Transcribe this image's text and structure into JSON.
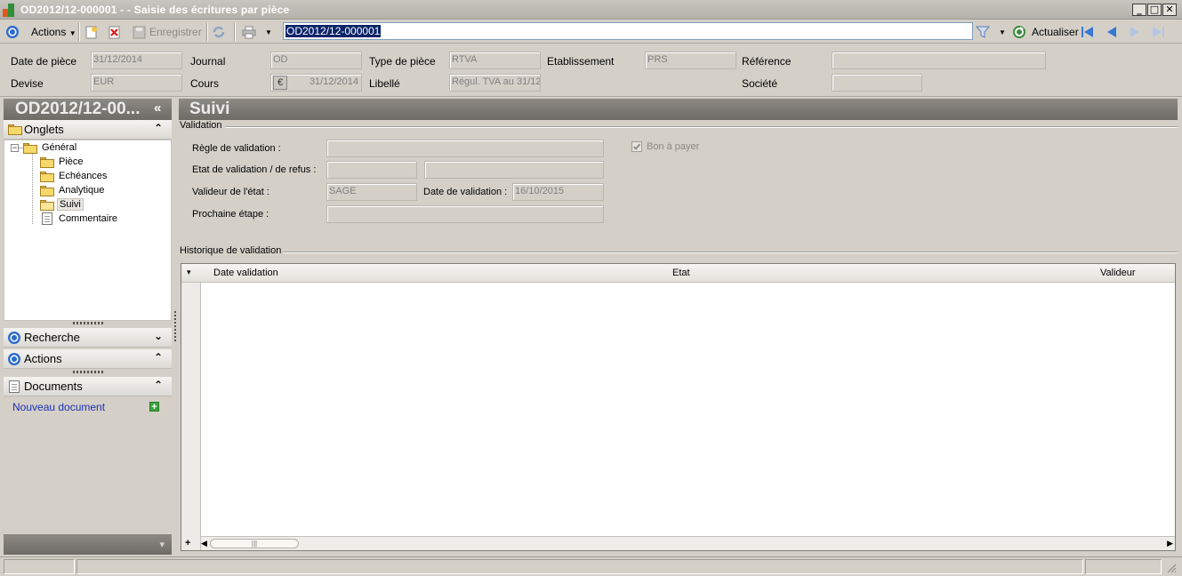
{
  "window": {
    "title": "OD2012/12-000001 -  - Saisie des écritures par pièce",
    "min": "_",
    "max": "□",
    "close": "✕"
  },
  "toolbar": {
    "actions_label": "Actions",
    "save_label": "Enregistrer",
    "document_number": "OD2012/12-000001",
    "refresh_label": "Actualiser"
  },
  "header": {
    "date_piece_label": "Date de pièce",
    "date_piece_value": "31/12/2014",
    "journal_label": "Journal",
    "journal_value": "OD",
    "type_piece_label": "Type de pièce",
    "type_piece_value": "RTVA",
    "etablissement_label": "Etablissement",
    "etablissement_value": "PRS",
    "reference_label": "Référence",
    "reference_value": "",
    "devise_label": "Devise",
    "devise_value": "EUR",
    "cours_label": "Cours",
    "cours_value": "31/12/2014",
    "cours_currency_symbol": "€",
    "libelle_label": "Libellé",
    "libelle_value": "Régul. TVA au 31/12",
    "societe_label": "Société",
    "societe_value": ""
  },
  "left_panel": {
    "title": "OD2012/12-00...",
    "collapse": "«",
    "onglets_label": "Onglets",
    "tree": {
      "root": "Général",
      "expander": "−",
      "items": [
        "Pièce",
        "Echéances",
        "Analytique",
        "Suivi",
        "Commentaire"
      ]
    },
    "recherche_label": "Recherche",
    "actions_label": "Actions",
    "documents_label": "Documents",
    "new_document_label": "Nouveau document",
    "new_document_plus": "+",
    "chev_up": "⌃",
    "chev_down": "⌄",
    "bottom_arrow": "▾"
  },
  "main": {
    "title": "Suivi",
    "validation_group": "Validation",
    "regle_label": "Règle de validation :",
    "regle_value": "",
    "etat_label": "Etat de validation / de refus :",
    "etat_value_1": "",
    "etat_value_2": "",
    "valideur_label": "Valideur de l'état :",
    "valideur_value": "SAGE",
    "date_validation_label": "Date de validation :",
    "date_validation_value": "16/10/2015",
    "prochaine_label": "Prochaine étape :",
    "prochaine_value": "",
    "bon_a_payer_label": "Bon à payer",
    "bon_a_payer_checked": true,
    "historique_group": "Historique de validation",
    "grid": {
      "columns": [
        "Date validation",
        "Etat",
        "Valideur"
      ],
      "rows": [],
      "add": "+",
      "scroll_left": "◀",
      "scroll_right": "▶",
      "scroll_grip": "|||",
      "column_menu": "▾"
    }
  }
}
